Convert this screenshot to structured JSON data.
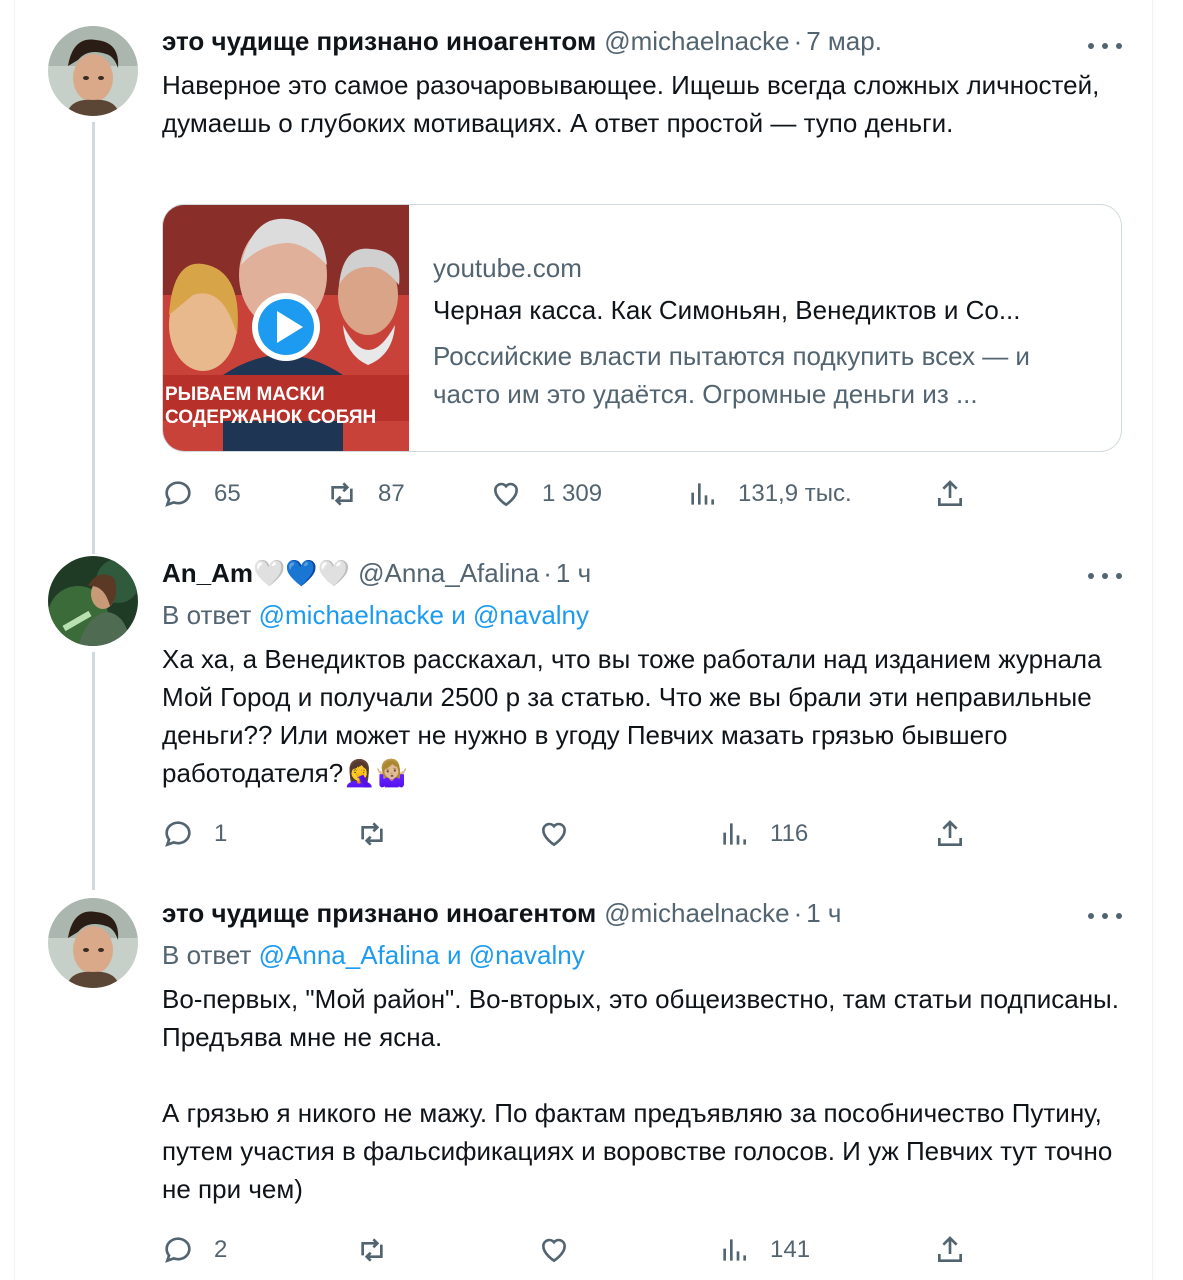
{
  "tweets": [
    {
      "name": "это чудище признано иноагентом",
      "handle": "@michaelnacke",
      "sep": "·",
      "time": "7 мар.",
      "text": "Наверное это самое разочаровывающее. Ищешь всегда сложных личностей, думаешь о глубоких мотивациях. А ответ простой — тупо деньги.",
      "card": {
        "domain": "youtube.com",
        "title": "Черная касса. Как Симоньян, Венедиктов и Со...",
        "description": "Российские власти пытаются подкупить всех — и часто им это удаётся. Огромные деньги из ...",
        "thumb_caption_line1": "РЫВАЕМ МАСКИ",
        "thumb_caption_line2": "СОДЕРЖАНОК СОБЯН"
      },
      "actions": {
        "replies": "65",
        "retweets": "87",
        "likes": "1 309",
        "views": "131,9 тыс."
      }
    },
    {
      "name": "An_Am",
      "name_emoji": "🤍💙🤍",
      "handle": "@Anna_Afalina",
      "sep": "·",
      "time": "1 ч",
      "reply_prefix": "В ответ",
      "reply_to_1": "@michaelnacke",
      "reply_and": "и",
      "reply_to_2": "@navalny",
      "text": "Ха ха, а Венедиктов расскахал, что вы тоже работали над изданием журнала Мой Город и получали 2500 р за статью. Что же вы брали эти неправильные деньги?? Или может не нужно в угоду Певчих мазать грязью бывшего работодателя?🤦‍♀️🤷🏼‍♀️",
      "actions": {
        "replies": "1",
        "retweets": "",
        "likes": "",
        "views": "116"
      }
    },
    {
      "name": "это чудище признано иноагентом",
      "handle": "@michaelnacke",
      "sep": "·",
      "time": "1 ч",
      "reply_prefix": "В ответ",
      "reply_to_1": "@Anna_Afalina",
      "reply_and": "и",
      "reply_to_2": "@navalny",
      "text": "Во-первых, \"Мой район\". Во-вторых, это общеизвестно, там статьи подписаны. Предъява мне не ясна.\n\nА грязью я никого не мажу. По фактам предъявляю за пособничество Путину, путем участия в фальсификациях и воровстве голосов. И уж Певчих тут точно не при чем)",
      "actions": {
        "replies": "2",
        "retweets": "",
        "likes": "",
        "views": "141"
      }
    }
  ],
  "icons": [
    "reply-icon",
    "retweet-icon",
    "like-icon",
    "views-icon",
    "share-icon",
    "more-icon",
    "play-icon"
  ],
  "colors": {
    "link": "#1d9bf0",
    "secondary": "#536471",
    "text": "#0f1419",
    "border": "#cfd9de"
  }
}
